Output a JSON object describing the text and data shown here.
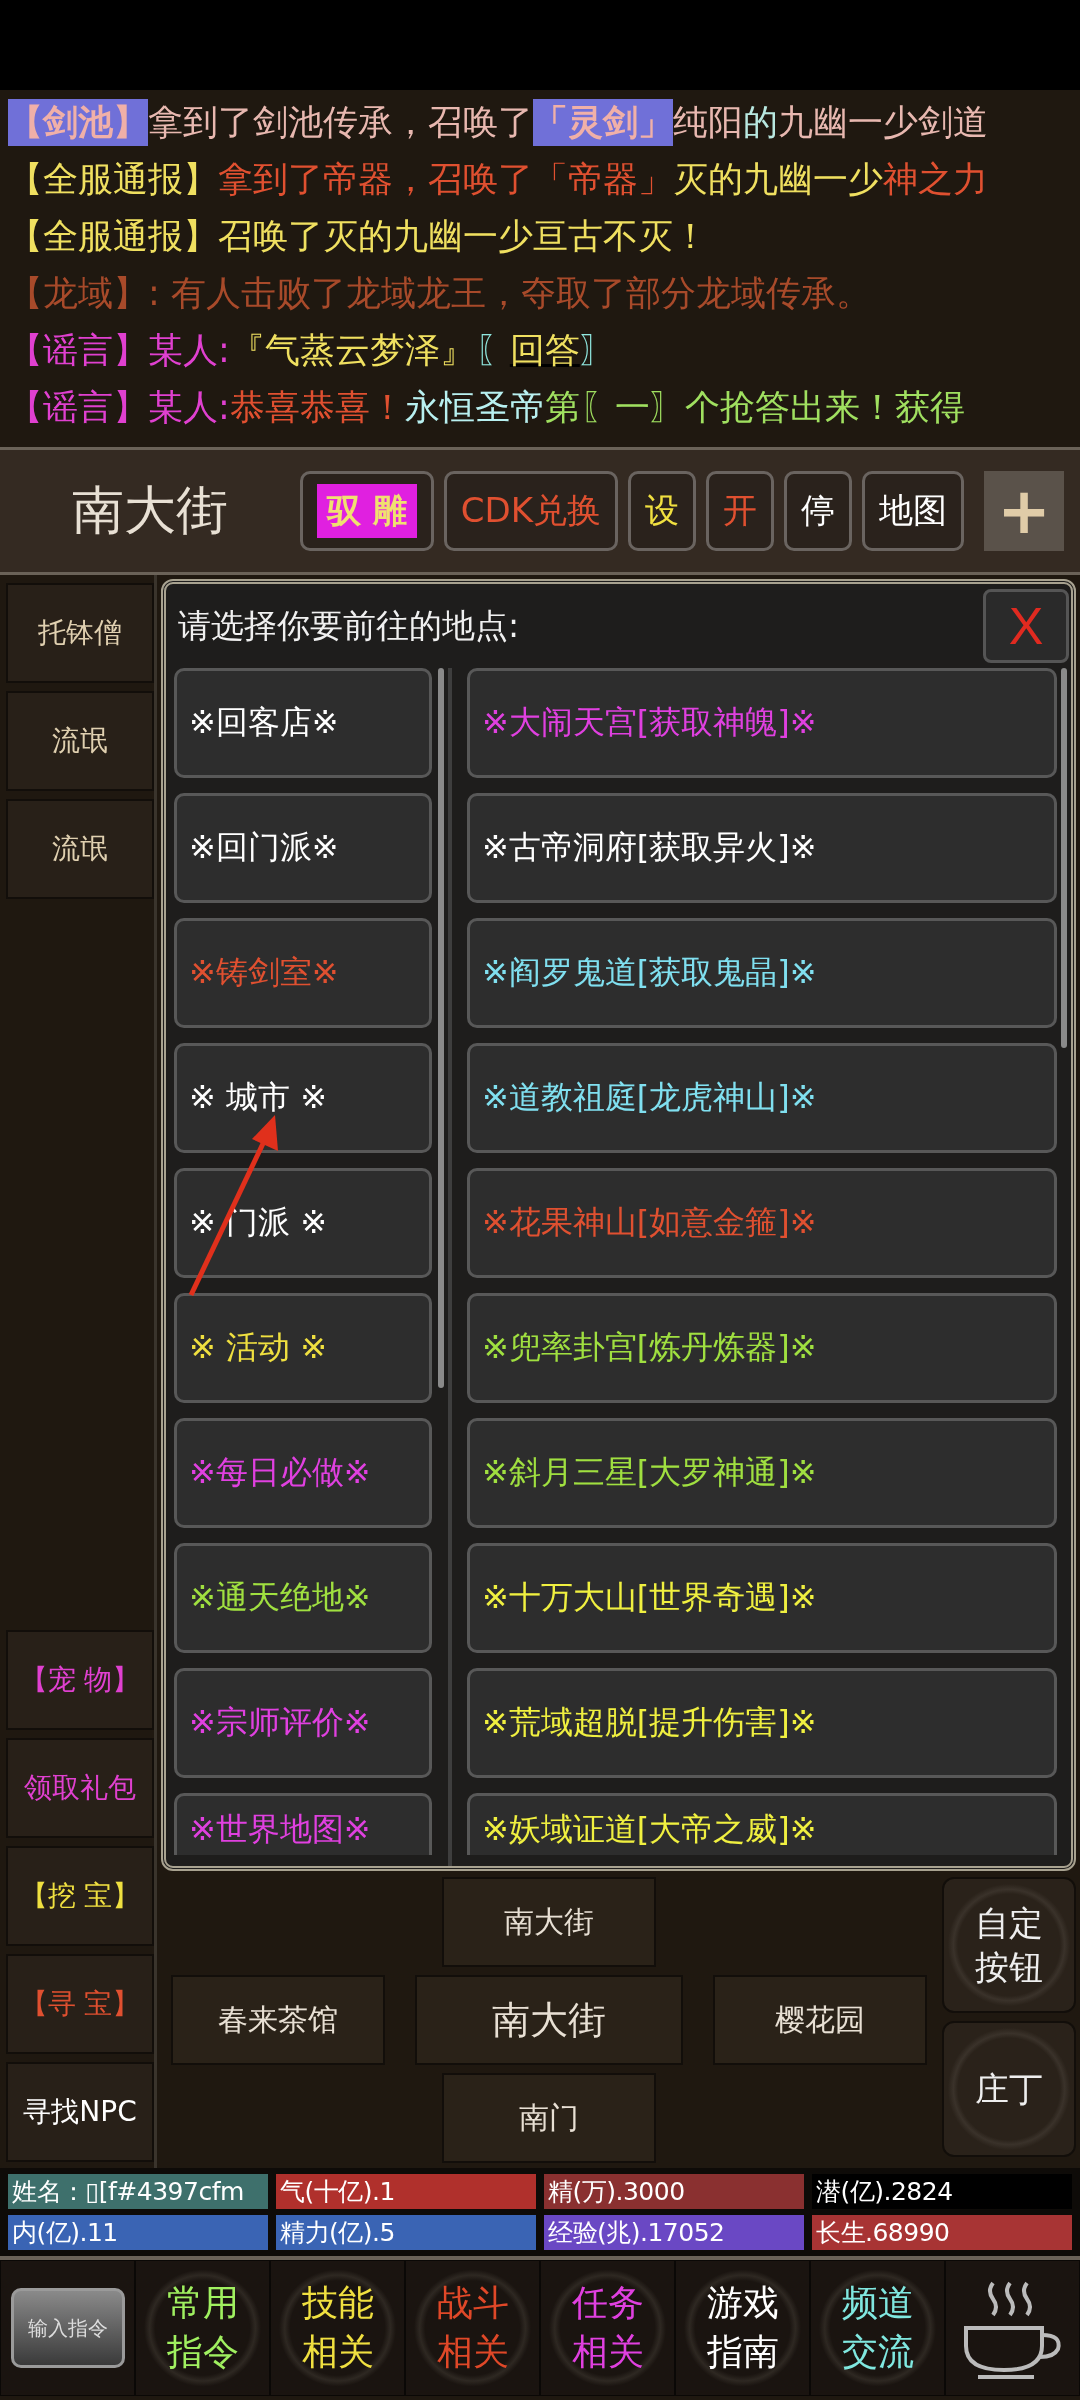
{
  "messages": [
    [
      {
        "text": "【剑池】",
        "color": "#f0b0a8",
        "highlight": true
      },
      {
        "text": "拿到了剑池传承，召唤了",
        "color": "#e8b8b0"
      },
      {
        "text": "「灵剑」",
        "color": "#f0b0a8",
        "highlight": true
      },
      {
        "text": "纯阳",
        "color": "#e8b8b0"
      },
      {
        "text": "的",
        "color": "#b8e8e0"
      },
      {
        "text": "九幽一少剑道",
        "color": "#e8b8b0"
      }
    ],
    [
      {
        "text": "【全服通报】",
        "color": "#f0e060"
      },
      {
        "text": "拿到了帝器，召唤了「帝器」",
        "color": "#e05030"
      },
      {
        "text": "灭的九幽一少",
        "color": "#f0e060"
      },
      {
        "text": "神之力",
        "color": "#e05030"
      }
    ],
    [
      {
        "text": "【全服通报】召唤了灭的九幽一少亘古不灭！",
        "color": "#f0e060"
      }
    ],
    [
      {
        "text": "【龙域】: 有人击败了龙域龙王，夺取了部分龙域传承。",
        "color": "#a84a2a"
      }
    ],
    [
      {
        "text": "【谣言】某人: ",
        "color": "#e040d0"
      },
      {
        "text": "『气蒸云梦泽』",
        "color": "#f0e060"
      },
      {
        "text": "〖",
        "color": "#90e8e0"
      },
      {
        "text": "回答",
        "color": "#f0e060",
        "underline": true
      },
      {
        "text": "〗",
        "color": "#90e8e0"
      }
    ],
    [
      {
        "text": "【谣言】某人: ",
        "color": "#e040d0"
      },
      {
        "text": "恭喜恭喜！",
        "color": "#e05030"
      },
      {
        "text": "永恒圣帝",
        "color": "#b8f0f0"
      },
      {
        "text": "第〖一〗个抢答出来！获得",
        "color": "#a0e060"
      }
    ]
  ],
  "header": {
    "title": "南大街",
    "buttons": [
      {
        "label": "驭 雕",
        "color": "#f0e070",
        "kind": "highlight"
      },
      {
        "label": "CDK兑换",
        "color": "#e05030",
        "kind": "plain"
      },
      {
        "label": "设",
        "color": "#f0e040",
        "kind": "plain"
      },
      {
        "label": "开",
        "color": "#e05030",
        "kind": "plain"
      },
      {
        "label": "停",
        "color": "#ffffff",
        "kind": "plain"
      },
      {
        "label": "地图",
        "color": "#ffffff",
        "kind": "plain"
      },
      {
        "label": "+",
        "color": "#e0cca8",
        "kind": "add"
      }
    ]
  },
  "sidebar": {
    "npcs": [
      {
        "label": "托钵僧",
        "color": "#e0d0b0"
      },
      {
        "label": "流氓",
        "color": "#e0d0b0"
      },
      {
        "label": "流氓",
        "color": "#e0d0b0"
      }
    ],
    "actions": [
      {
        "label": "【宠 物】",
        "color": "#e040d0"
      },
      {
        "label": "领取礼包",
        "color": "#e040d0"
      },
      {
        "label": "【挖 宝】",
        "color": "#f0e040"
      },
      {
        "label": "【寻 宝】",
        "color": "#e05030"
      },
      {
        "label": "寻找NPC",
        "color": "#ffffff"
      }
    ]
  },
  "dialog": {
    "title": "请选择你要前往的地点:",
    "close": "X",
    "left": [
      {
        "label": "※回客店※",
        "color": "#ffffff"
      },
      {
        "label": "※回门派※",
        "color": "#ffffff"
      },
      {
        "label": "※铸剑室※",
        "color": "#e05030"
      },
      {
        "label": "※ 城市 ※",
        "color": "#ffffff"
      },
      {
        "label": "※ 门派 ※",
        "color": "#ffffff"
      },
      {
        "label": "※ 活动 ※",
        "color": "#f0e040"
      },
      {
        "label": "※每日必做※",
        "color": "#e040e0"
      },
      {
        "label": "※通天绝地※",
        "color": "#a0e040"
      },
      {
        "label": "※宗师评价※",
        "color": "#e040e0"
      },
      {
        "label": "※世界地图※",
        "color": "#e040e0"
      }
    ],
    "right": [
      {
        "label": "※大闹天宫[获取神魄]※",
        "color": "#e040e0"
      },
      {
        "label": "※古帝洞府[获取异火]※",
        "color": "#ffffff"
      },
      {
        "label": "※阎罗鬼道[获取鬼晶]※",
        "color": "#80e0f0"
      },
      {
        "label": "※道教祖庭[龙虎神山]※",
        "color": "#80e0f0"
      },
      {
        "label": "※花果神山[如意金箍]※",
        "color": "#e05030"
      },
      {
        "label": "※兜率卦宫[炼丹炼器]※",
        "color": "#a0e040"
      },
      {
        "label": "※斜月三星[大罗神通]※",
        "color": "#a0e040"
      },
      {
        "label": "※十万大山[世界奇遇]※",
        "color": "#f0f040"
      },
      {
        "label": "※荒域超脱[提升伤害]※",
        "color": "#f0f040"
      },
      {
        "label": "※妖域证道[大帝之威]※",
        "color": "#f0f040"
      }
    ]
  },
  "navigation": {
    "north": "南大街",
    "west": "春来茶馆",
    "center": "南大街",
    "east": "樱花园",
    "south": "南门",
    "side": [
      "自定按钮",
      "庄丁"
    ]
  },
  "stats": [
    {
      "text": "姓名：▯[f#4397cfm",
      "color": "#3e706c"
    },
    {
      "text": "气(十亿).1",
      "color": "#b0302c"
    },
    {
      "text": "精(万).3000",
      "color": "#8a3030"
    },
    {
      "text": "潜(亿).2824",
      "color": "#000000"
    },
    {
      "text": "内(亿).11",
      "color": "#3a64b4"
    },
    {
      "text": "精力(亿).5",
      "color": "#3a64b4"
    },
    {
      "text": "经验(兆).17052",
      "color": "#6a48c4"
    },
    {
      "text": "长生.68990",
      "color": "#a83434"
    }
  ],
  "toolbar": {
    "input_button": "输入指令",
    "menus": [
      {
        "lines": [
          "常用",
          "指令"
        ],
        "color": "#a0f060"
      },
      {
        "lines": [
          "技能",
          "相关"
        ],
        "color": "#f0e040"
      },
      {
        "lines": [
          "战斗",
          "相关"
        ],
        "color": "#e04828"
      },
      {
        "lines": [
          "任务",
          "相关"
        ],
        "color": "#e040e0"
      },
      {
        "lines": [
          "游戏",
          "指南"
        ],
        "color": "#ffffff"
      },
      {
        "lines": [
          "频道",
          "交流"
        ],
        "color": "#80e8e0"
      }
    ]
  }
}
